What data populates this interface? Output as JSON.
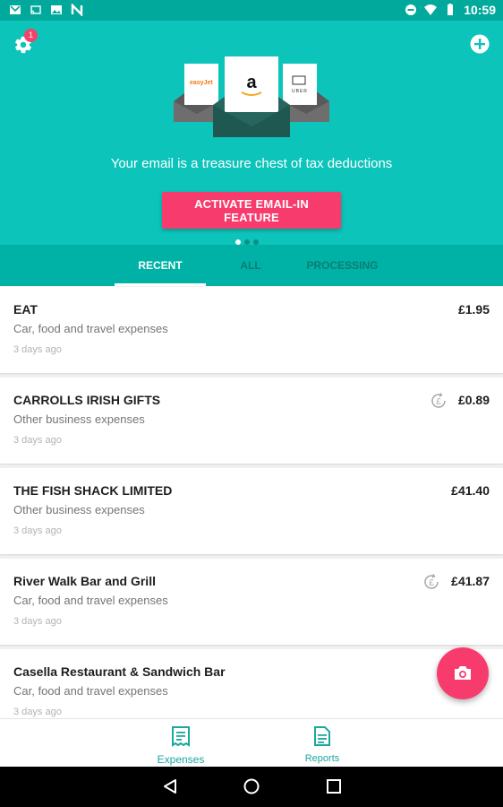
{
  "status_bar": {
    "time": "10:59",
    "left_icons": [
      "gmail-icon",
      "cast-icon",
      "image-icon",
      "n-icon"
    ],
    "right_icons": [
      "dnd-icon",
      "wifi-icon",
      "battery-icon"
    ]
  },
  "header": {
    "notification_badge": "1",
    "tagline": "Your email is a treasure chest of tax deductions",
    "activate_button": "ACTIVATE EMAIL-IN FEATURE",
    "carousel_pages": 3,
    "carousel_active": 0,
    "illustration": {
      "left_brand": "easyJet",
      "center_brand": "a",
      "right_brand": "UBER"
    }
  },
  "tabs": [
    {
      "label": "RECENT",
      "active": true
    },
    {
      "label": "ALL",
      "active": false
    },
    {
      "label": "PROCESSING",
      "active": false
    }
  ],
  "expenses": [
    {
      "merchant": "EAT",
      "category": "Car, food and travel expenses",
      "date": "3 days ago",
      "amount": "£1.95",
      "processing": false
    },
    {
      "merchant": "CARROLLS IRISH GIFTS",
      "category": "Other business expenses",
      "date": "3 days ago",
      "amount": "£0.89",
      "processing": true
    },
    {
      "merchant": "THE FISH SHACK LIMITED",
      "category": "Other business expenses",
      "date": "3 days ago",
      "amount": "£41.40",
      "processing": false
    },
    {
      "merchant": "River Walk Bar and Grill",
      "category": "Car, food and travel expenses",
      "date": "3 days ago",
      "amount": "£41.87",
      "processing": true
    },
    {
      "merchant": "Casella Restaurant & Sandwich Bar",
      "category": "Car, food and travel expenses",
      "date": "3 days ago",
      "amount": "",
      "processing": false
    }
  ],
  "bottom_nav": {
    "expenses_label": "Expenses",
    "reports_label": "Reports"
  },
  "colors": {
    "teal": "#0cc4ba",
    "teal_dark": "#00b2a6",
    "accent_pink": "#f73c6d",
    "nav_teal": "#1aa89e"
  }
}
